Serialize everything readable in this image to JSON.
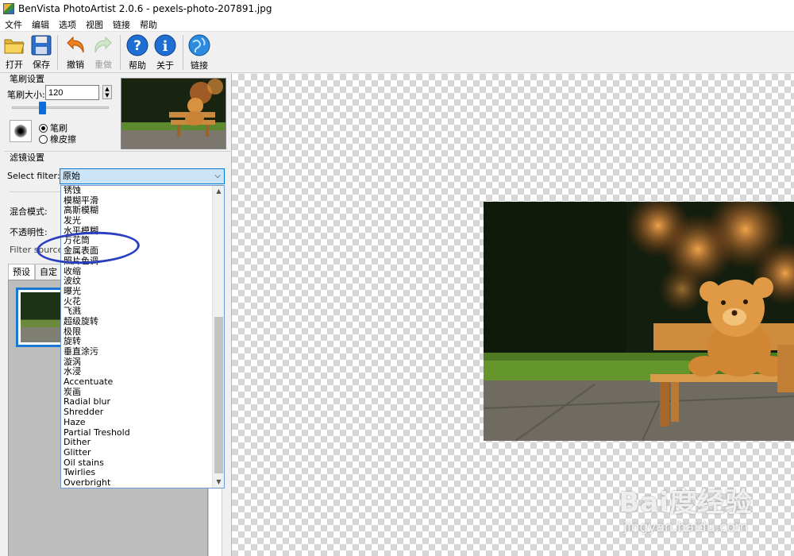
{
  "window": {
    "title": "BenVista PhotoArtist 2.0.6 - pexels-photo-207891.jpg"
  },
  "menu": [
    "文件",
    "编辑",
    "选项",
    "视图",
    "链接",
    "帮助"
  ],
  "toolbar": {
    "open": "打开",
    "save": "保存",
    "undo": "撤销",
    "redo": "重做",
    "help": "帮助",
    "about": "关于",
    "link": "链接"
  },
  "brush_settings": {
    "title": "笔刷设置",
    "size_label": "笔刷大小:",
    "size_value": "120",
    "size_level": 0.3,
    "options": [
      {
        "label": "笔刷",
        "selected": true
      },
      {
        "label": "橡皮擦",
        "selected": false
      }
    ]
  },
  "filter_settings": {
    "title": "滤镜设置",
    "select_label": "Select filter:",
    "selected": "原始",
    "blend_label": "混合模式:",
    "opacity_label": "不透明性:",
    "source_label": "Filter source:"
  },
  "filter_list": [
    "锈蚀",
    "模糊平滑",
    "高斯模糊",
    "发光",
    "水平模糊",
    "万花筒",
    "金属表面",
    "照片色调",
    "收缩",
    "波纹",
    "曝光",
    "火花",
    "飞溅",
    "超级旋转",
    "极限",
    "旋转",
    "垂直涂污",
    "漩涡",
    "水浸",
    "Accentuate",
    "炭画",
    "Radial blur",
    "Shredder",
    "Haze",
    "Partial Treshold",
    "Dither",
    "Glitter",
    "Oil stains",
    "Twirlies",
    "Overbright"
  ],
  "preset_tabs": [
    "预设",
    "自定"
  ],
  "colors": {
    "accent": "#0078d7",
    "annotation": "#2a3fbf"
  },
  "watermark": {
    "logo": "Bai度经验",
    "url": "jingyan.baidu.com"
  }
}
